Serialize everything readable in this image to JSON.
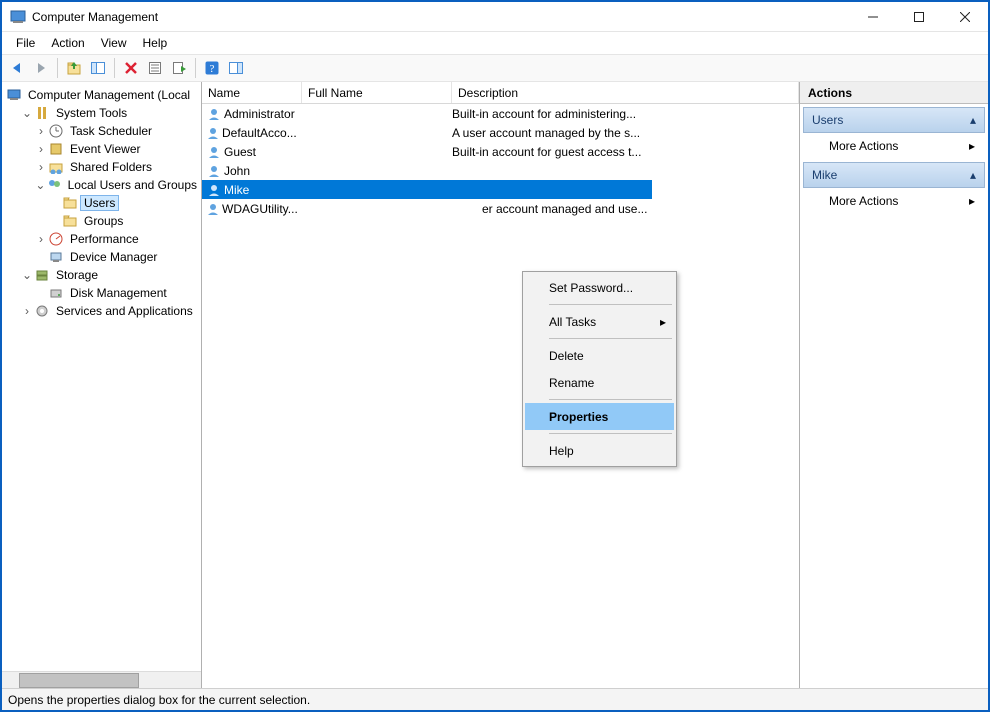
{
  "window": {
    "title": "Computer Management"
  },
  "menubar": {
    "file": "File",
    "action": "Action",
    "view": "View",
    "help": "Help"
  },
  "tree": {
    "root": "Computer Management (Local",
    "systools": "System Tools",
    "tasksched": "Task Scheduler",
    "eventviewer": "Event Viewer",
    "sharedfolders": "Shared Folders",
    "localusers": "Local Users and Groups",
    "users": "Users",
    "groups": "Groups",
    "performance": "Performance",
    "devicemgr": "Device Manager",
    "storage": "Storage",
    "diskmgmt": "Disk Management",
    "services": "Services and Applications"
  },
  "list": {
    "col_name": "Name",
    "col_fullname": "Full Name",
    "col_desc": "Description",
    "rows": [
      {
        "name": "Administrator",
        "full": "",
        "desc": "Built-in account for administering..."
      },
      {
        "name": "DefaultAcco...",
        "full": "",
        "desc": "A user account managed by the s..."
      },
      {
        "name": "Guest",
        "full": "",
        "desc": "Built-in account for guest access t..."
      },
      {
        "name": "John",
        "full": "",
        "desc": ""
      },
      {
        "name": "Mike",
        "full": "",
        "desc": ""
      },
      {
        "name": "WDAGUtility...",
        "full": "",
        "desc": "er account managed and use..."
      }
    ]
  },
  "context_menu": {
    "set_password": "Set Password...",
    "all_tasks": "All Tasks",
    "delete": "Delete",
    "rename": "Rename",
    "properties": "Properties",
    "help": "Help"
  },
  "actions": {
    "title": "Actions",
    "group_users": "Users",
    "group_mike": "Mike",
    "more_actions": "More Actions"
  },
  "statusbar": {
    "text": "Opens the properties dialog box for the current selection."
  }
}
